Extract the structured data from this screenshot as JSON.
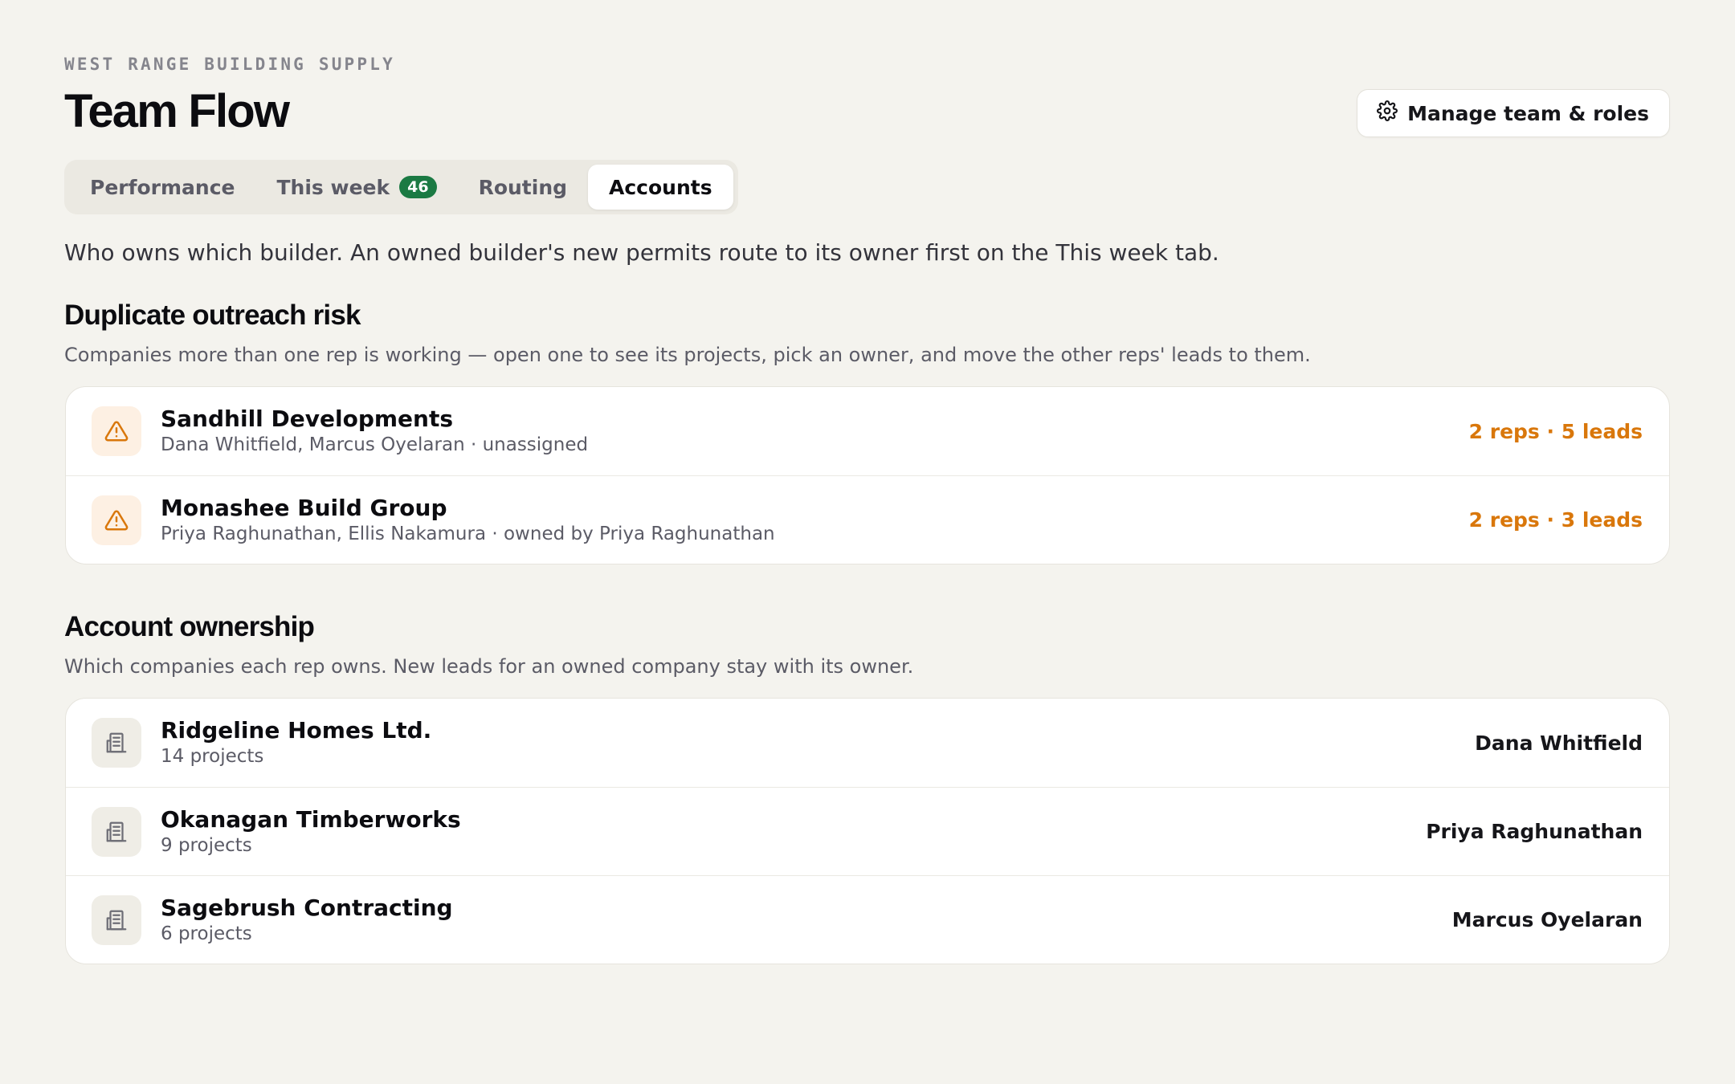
{
  "header": {
    "eyebrow": "WEST RANGE BUILDING SUPPLY",
    "title": "Team Flow",
    "manage_label": "Manage team & roles"
  },
  "tabs": [
    {
      "label": "Performance"
    },
    {
      "label": "This week",
      "badge": "46"
    },
    {
      "label": "Routing"
    },
    {
      "label": "Accounts",
      "active": true
    }
  ],
  "intro": "Who owns which builder. An owned builder's new permits route to its owner first on the This week tab.",
  "duplicate": {
    "title": "Duplicate outreach risk",
    "subtitle": "Companies more than one rep is working — open one to see its projects, pick an owner, and move the other reps' leads to them.",
    "rows": [
      {
        "name": "Sandhill Developments",
        "meta": "Dana Whitfield, Marcus Oyelaran · unassigned",
        "stat": "2 reps · 5 leads"
      },
      {
        "name": "Monashee Build Group",
        "meta": "Priya Raghunathan, Ellis Nakamura · owned by Priya Raghunathan",
        "stat": "2 reps · 3 leads"
      }
    ]
  },
  "ownership": {
    "title": "Account ownership",
    "subtitle": "Which companies each rep owns. New leads for an owned company stay with its owner.",
    "rows": [
      {
        "name": "Ridgeline Homes Ltd.",
        "meta": "14 projects",
        "owner": "Dana Whitfield"
      },
      {
        "name": "Okanagan Timberworks",
        "meta": "9 projects",
        "owner": "Priya Raghunathan"
      },
      {
        "name": "Sagebrush Contracting",
        "meta": "6 projects",
        "owner": "Marcus Oyelaran"
      }
    ]
  },
  "colors": {
    "background": "#f4f3ee",
    "badge": "#1b7a43",
    "warning": "#d9770b"
  },
  "icons": {
    "manage": "gear-icon",
    "duplicate_row": "warning-triangle-icon",
    "ownership_row": "building-icon"
  }
}
